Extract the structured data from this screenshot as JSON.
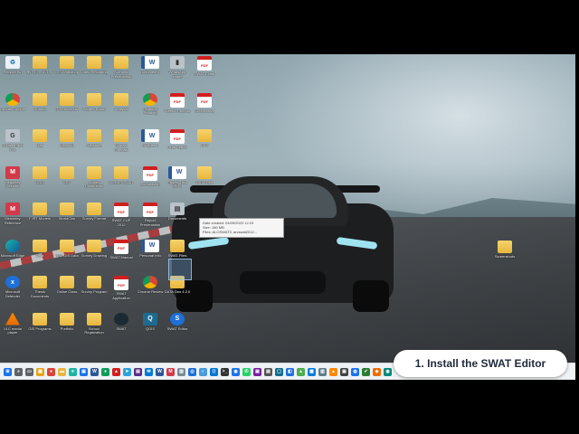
{
  "caption": {
    "text": "1. Install the SWAT Editor"
  },
  "tooltip": {
    "line1": "Date created: 04/09/2023 12:23",
    "line2": "Size: 180 MB",
    "line3": "Files: ALOSWAT3, arcswat2012..."
  },
  "desktop_icons": [
    {
      "label": "Recycle Bin",
      "type": "recycle",
      "glyph": "♻"
    },
    {
      "label": "Google Chrome",
      "type": "chrome",
      "glyph": ""
    },
    {
      "label": "Google Earth Pro",
      "type": "gray-app",
      "glyph": "G"
    },
    {
      "label": "Mendeley Desktop",
      "type": "red-app",
      "glyph": "M"
    },
    {
      "label": "Mendeley Reference",
      "type": "red-app",
      "glyph": "M"
    },
    {
      "label": "Microsoft Edge",
      "type": "edge",
      "glyph": ""
    },
    {
      "label": "Microsoft Defender",
      "type": "blue-app",
      "glyph": "x"
    },
    {
      "label": "VLC media player",
      "type": "vlc",
      "glyph": ""
    },
    {
      "label": "新しいフォルダ",
      "type": "folder",
      "glyph": ""
    },
    {
      "label": "Shared",
      "type": "folder",
      "glyph": ""
    },
    {
      "label": "Map",
      "type": "folder",
      "glyph": ""
    },
    {
      "label": "QGIS",
      "type": "folder",
      "glyph": ""
    },
    {
      "label": "FJRT Models",
      "type": "folder",
      "glyph": ""
    },
    {
      "label": "Data",
      "type": "folder",
      "glyph": ""
    },
    {
      "label": "Thesis Documents",
      "type": "folder",
      "glyph": ""
    },
    {
      "label": "GIS Programs",
      "type": "folder",
      "glyph": ""
    },
    {
      "label": "GIS Workshop",
      "type": "folder",
      "glyph": ""
    },
    {
      "label": "GIS University",
      "type": "folder",
      "glyph": ""
    },
    {
      "label": "Keyword",
      "type": "folder",
      "glyph": ""
    },
    {
      "label": "CSV",
      "type": "folder",
      "glyph": ""
    },
    {
      "label": "WorldClim",
      "type": "folder",
      "glyph": ""
    },
    {
      "label": "NST GIS Data",
      "type": "folder",
      "glyph": ""
    },
    {
      "label": "Online Class",
      "type": "folder",
      "glyph": ""
    },
    {
      "label": "Portfolio",
      "type": "folder",
      "glyph": ""
    },
    {
      "label": "Video Recording",
      "type": "folder",
      "glyph": ""
    },
    {
      "label": "Partner Board",
      "type": "folder",
      "glyph": ""
    },
    {
      "label": "Capstone",
      "type": "folder",
      "glyph": ""
    },
    {
      "label": "Survey Documents",
      "type": "folder",
      "glyph": ""
    },
    {
      "label": "Survey Format",
      "type": "folder",
      "glyph": ""
    },
    {
      "label": "Survey Drawing",
      "type": "folder",
      "glyph": ""
    },
    {
      "label": "Survey Program",
      "type": "folder",
      "glyph": ""
    },
    {
      "label": "School Registration",
      "type": "folder",
      "glyph": ""
    },
    {
      "label": "Scientific Presentation",
      "type": "folder",
      "glyph": ""
    },
    {
      "label": "Analysis",
      "type": "folder",
      "glyph": ""
    },
    {
      "label": "Climate Forecast",
      "type": "folder",
      "glyph": ""
    },
    {
      "label": "WEBER SWAT",
      "type": "folder",
      "glyph": ""
    },
    {
      "label": "SWAT-CUP 2012",
      "type": "pdf",
      "glyph": "PDF"
    },
    {
      "label": "SWAT Manual",
      "type": "pdf",
      "glyph": "PDF"
    },
    {
      "label": "SWAT Application",
      "type": "pdf",
      "glyph": "PDF"
    },
    {
      "label": "SWAT",
      "type": "dark-app",
      "glyph": ""
    },
    {
      "label": "Document 1",
      "type": "word",
      "glyph": "W"
    },
    {
      "label": "Technical Reading",
      "type": "chrome",
      "glyph": ""
    },
    {
      "label": "Chapter 1",
      "type": "word",
      "glyph": "W"
    },
    {
      "label": "Scholarship",
      "type": "pdf",
      "glyph": "PDF"
    },
    {
      "label": "Report Presentation",
      "type": "pdf",
      "glyph": "PDF"
    },
    {
      "label": "Personal Info",
      "type": "word",
      "glyph": "W"
    },
    {
      "label": "Chrome Review",
      "type": "chrome",
      "glyph": ""
    },
    {
      "label": "QGIS",
      "type": "teal-app",
      "glyph": "Q"
    },
    {
      "label": "WhatsApp Image",
      "type": "gray-app",
      "glyph": "▮"
    },
    {
      "label": "Weekly Reports",
      "type": "pdf",
      "glyph": "PDF"
    },
    {
      "label": "Final Report",
      "type": "pdf",
      "glyph": "PDF"
    },
    {
      "label": "Project Task (BIF)",
      "type": "word",
      "glyph": "W"
    },
    {
      "label": "Documents",
      "type": "gray-app",
      "glyph": "▤"
    },
    {
      "label": "SWAT-Files",
      "type": "folder",
      "glyph": ""
    },
    {
      "label": "DATA Geo 4.2.0",
      "type": "folder",
      "glyph": ""
    },
    {
      "label": "SWAT Editor",
      "type": "blue-app",
      "glyph": "S"
    },
    {
      "label": "SWAT Exam",
      "type": "pdf",
      "glyph": "PDF"
    },
    {
      "label": "Cooperative",
      "type": "pdf",
      "glyph": "PDF"
    },
    {
      "label": "ANY",
      "type": "folder",
      "glyph": ""
    },
    {
      "label": "DATA Geo",
      "type": "folder",
      "glyph": ""
    },
    {
      "label": "Screenshots",
      "type": "folder",
      "glyph": ""
    }
  ],
  "taskbar_items": [
    {
      "name": "start-button",
      "color": "#1a73e8",
      "glyph": "⊞"
    },
    {
      "name": "search-icon",
      "color": "#5f6368",
      "glyph": "⌕"
    },
    {
      "name": "task-view-icon",
      "color": "#5f6368",
      "glyph": "▭"
    },
    {
      "name": "widgets-icon",
      "color": "#e8a317",
      "glyph": "▦"
    },
    {
      "name": "chrome-icon",
      "color": "#db4437",
      "glyph": "●"
    },
    {
      "name": "file-explorer-icon",
      "color": "#e8b73e",
      "glyph": "▬"
    },
    {
      "name": "edge-icon",
      "color": "#1bb5a0",
      "glyph": "e"
    },
    {
      "name": "store-icon",
      "color": "#1a73e8",
      "glyph": "▣"
    },
    {
      "name": "app-icon",
      "color": "#2b579a",
      "glyph": "W"
    },
    {
      "name": "chrome-icon-2",
      "color": "#0f9d58",
      "glyph": "●"
    },
    {
      "name": "app-icon-2",
      "color": "#d01f1f",
      "glyph": "▲"
    },
    {
      "name": "telegram-icon",
      "color": "#2aa3df",
      "glyph": "➤"
    },
    {
      "name": "app-icon-3",
      "color": "#5a2d82",
      "glyph": "▤"
    },
    {
      "name": "app-icon-4",
      "color": "#0078d4",
      "glyph": "✉"
    },
    {
      "name": "app-icon-5",
      "color": "#2b579a",
      "glyph": "W"
    },
    {
      "name": "app-icon-6",
      "color": "#d23a4a",
      "glyph": "M"
    },
    {
      "name": "app-icon-7",
      "color": "#7b8a96",
      "glyph": "▥"
    },
    {
      "name": "app-icon-8",
      "color": "#1e6fd8",
      "glyph": "◎"
    },
    {
      "name": "app-icon-9",
      "color": "#4a9bd9",
      "glyph": "◐"
    },
    {
      "name": "vscode-icon",
      "color": "#0078d4",
      "glyph": "⟨⟩"
    },
    {
      "name": "terminal-icon",
      "color": "#333",
      "glyph": ">_"
    },
    {
      "name": "app-icon-10",
      "color": "#1a73e8",
      "glyph": "◉"
    },
    {
      "name": "whatsapp-icon",
      "color": "#25d366",
      "glyph": "✆"
    },
    {
      "name": "app-icon-11",
      "color": "#7b1fa2",
      "glyph": "▣"
    },
    {
      "name": "app-icon-12",
      "color": "#555",
      "glyph": "▤"
    },
    {
      "name": "app-icon-13",
      "color": "#0f6c8f",
      "glyph": "▢"
    },
    {
      "name": "app-icon-14",
      "color": "#1e6fd8",
      "glyph": "◧"
    },
    {
      "name": "app-icon-15",
      "color": "#4caf50",
      "glyph": "▲"
    },
    {
      "name": "app-icon-16",
      "color": "#0b7dda",
      "glyph": "▦"
    },
    {
      "name": "app-icon-17",
      "color": "#607d8b",
      "glyph": "▥"
    },
    {
      "name": "vlc-icon",
      "color": "#ff8800",
      "glyph": "▲"
    },
    {
      "name": "app-icon-18",
      "color": "#444",
      "glyph": "▣"
    },
    {
      "name": "app-icon-19",
      "color": "#1a73e8",
      "glyph": "◍"
    },
    {
      "name": "app-icon-20",
      "color": "#2e7d32",
      "glyph": "✔"
    },
    {
      "name": "app-icon-21",
      "color": "#ef6c00",
      "glyph": "◆"
    },
    {
      "name": "app-icon-22",
      "color": "#00897b",
      "glyph": "◉"
    }
  ]
}
